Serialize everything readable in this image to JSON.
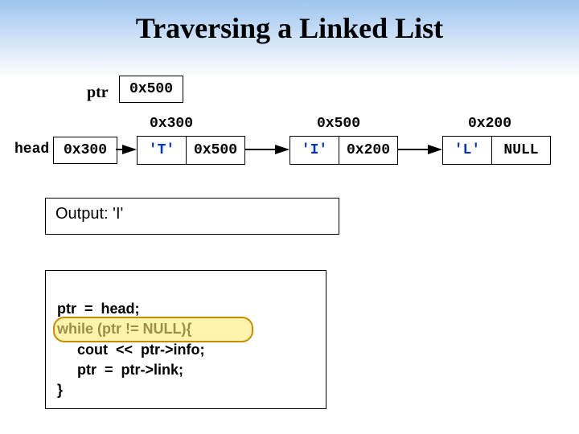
{
  "title": "Traversing a Linked List",
  "ptr": {
    "label": "ptr",
    "value": "0x500"
  },
  "head": {
    "label": "head",
    "value": "0x300"
  },
  "addrs": {
    "n1": "0x300",
    "n2": "0x500",
    "n3": "0x200"
  },
  "nodes": {
    "n1": {
      "info": "'T'",
      "link": "0x500"
    },
    "n2": {
      "info": "'I'",
      "link": "0x200"
    },
    "n3": {
      "info": "'L'",
      "link": "NULL"
    }
  },
  "output": {
    "label": "Output:",
    "value": "'I'"
  },
  "code": {
    "l1": "ptr  =  head;",
    "l2": "while (ptr != NULL){",
    "l3": "     cout  <<  ptr->info;",
    "l4": "     ptr  =  ptr->link;",
    "l5": "}"
  },
  "colors": {
    "info": "#0033cc"
  }
}
